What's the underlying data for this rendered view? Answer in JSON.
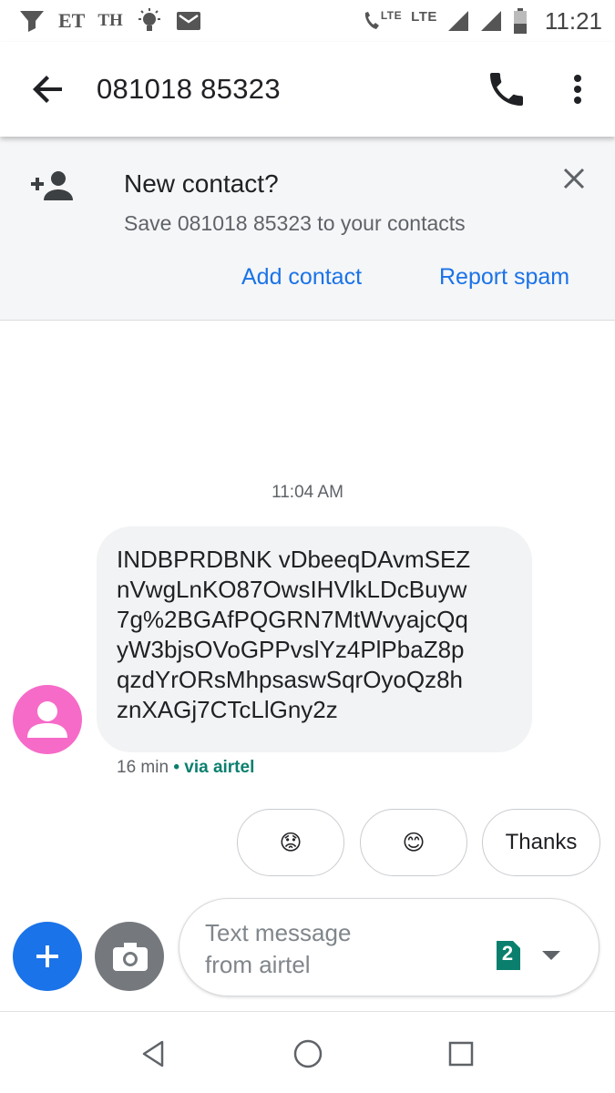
{
  "status_bar": {
    "carrier_1": "ET",
    "carrier_2": "TH",
    "lte_1": "LTE",
    "lte_2": "LTE",
    "time": "11:21",
    "icons": [
      "wifi-funnel-icon",
      "lightbulb-icon",
      "gmail-icon",
      "volte-call-icon",
      "signal-icon",
      "signal-icon",
      "battery-icon"
    ]
  },
  "app_bar": {
    "title": "081018 85323",
    "icons": [
      "back-arrow-icon",
      "phone-icon",
      "more-vert-icon"
    ]
  },
  "banner": {
    "title": "New contact?",
    "subtitle": "Save 081018 85323 to your contacts",
    "add_contact_label": "Add contact",
    "report_spam_label": "Report spam",
    "icons": [
      "add-person-icon",
      "close-icon"
    ]
  },
  "conversation": {
    "timestamp": "11:04 AM",
    "message": {
      "text": "INDBPRDBNK vDbeeqDAvmSEZ\nnVwgLnKO87OwsIHVlkLDcBuyw\n7g%2BGAfPQGRN7MtWvyajcQq\nyW3bjsOVoGPPvslYz4PlPbaZ8p\nqzdYrORsMhpsaswSqrOyoQz8h\nznXAGj7CTcLlGny2z",
      "age": "16 min",
      "separator": "•",
      "via": "via airtel"
    }
  },
  "smart_replies": [
    {
      "label": "😟",
      "icon": "worried-face-emoji"
    },
    {
      "label": "😊",
      "icon": "smiling-face-emoji"
    },
    {
      "label": "Thanks"
    }
  ],
  "compose": {
    "placeholder": "Text message\nfrom airtel",
    "sim_number": "2",
    "icons": [
      "plus-icon",
      "camera-icon",
      "sim-card-icon",
      "dropdown-arrow-icon"
    ]
  },
  "nav_bar": {
    "icons": [
      "nav-back-icon",
      "nav-home-icon",
      "nav-recents-icon"
    ]
  },
  "colors": {
    "accent": "#1a73e8",
    "avatar": "#f66bc8",
    "via_carrier": "#0b7f6e",
    "bubble": "#f1f3f4",
    "sim_badge": "#0b7f6e"
  }
}
